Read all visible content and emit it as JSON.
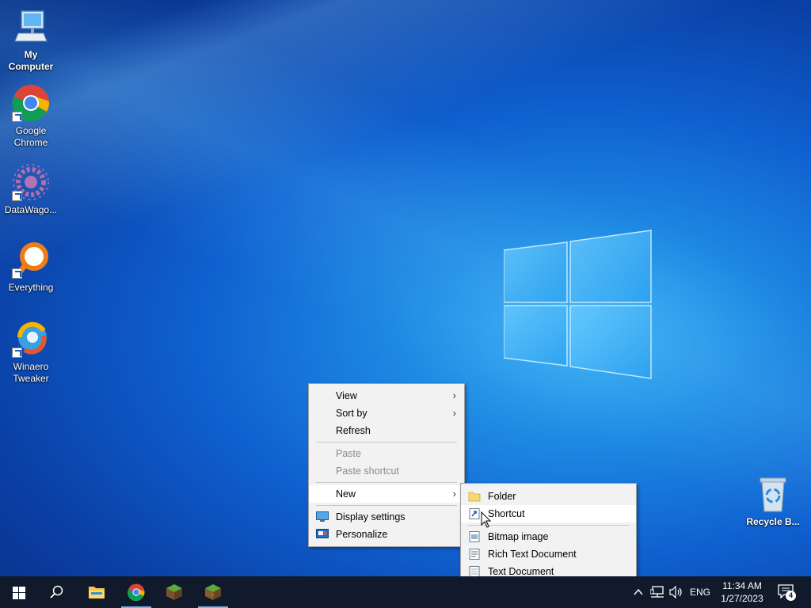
{
  "desktop": {
    "icons": [
      {
        "label1": "My",
        "label2": "Computer"
      },
      {
        "label1": "Google",
        "label2": "Chrome"
      },
      {
        "label1": "DataWago..."
      },
      {
        "label1": "Everything"
      },
      {
        "label1": "Winaero",
        "label2": "Tweaker"
      },
      {
        "label1": "Recycle B..."
      }
    ]
  },
  "context_menu": {
    "items": [
      "View",
      "Sort by",
      "Refresh",
      "Paste",
      "Paste shortcut",
      "New",
      "Display settings",
      "Personalize"
    ],
    "submenu_arrow": ">"
  },
  "new_submenu": {
    "items": [
      "Folder",
      "Shortcut",
      "Bitmap image",
      "Rich Text Document",
      "Text Document"
    ]
  },
  "taskbar": {
    "language": "ENG",
    "time": "11:34 AM",
    "date": "1/27/2023",
    "notification_count": "4"
  },
  "colors": {
    "taskbar": "#101a2a",
    "menu_bg": "#f2f2f2",
    "accent": "#76b9ed"
  }
}
